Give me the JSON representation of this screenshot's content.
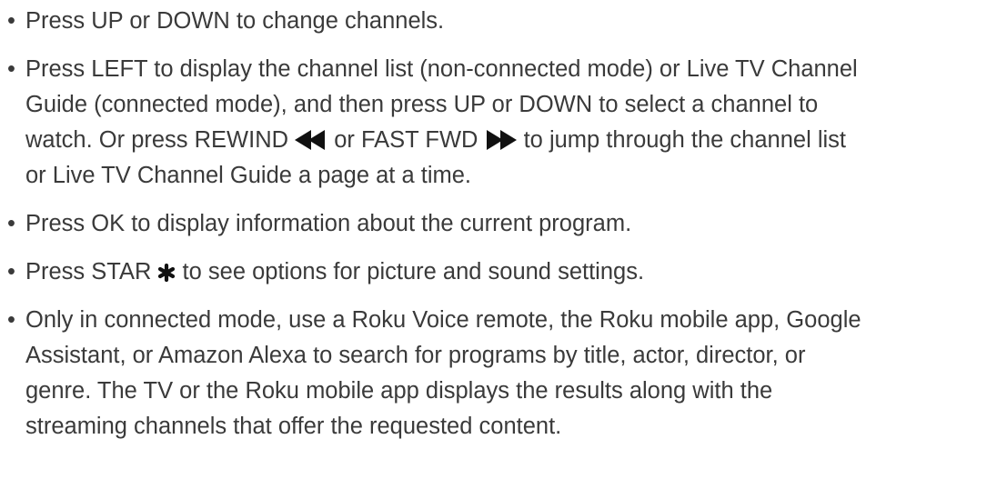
{
  "bullet_char": "•",
  "icons": {
    "rewind": "rewind-icon",
    "fast_forward": "fast-forward-icon",
    "star": "asterisk-icon"
  },
  "items": [
    {
      "lines": [
        "Press UP or DOWN to change channels."
      ]
    },
    {
      "lines": [
        "Press LEFT to display the channel list (non-connected mode) or Live TV Channel",
        "Guide (connected mode), and then press UP or DOWN to select a channel to"
      ],
      "line3_a": "watch. Or press REWIND ",
      "line3_b": " or FAST FWD ",
      "line3_c": " to jump through the channel list",
      "line4": "or Live TV Channel Guide a page at a time."
    },
    {
      "lines": [
        "Press OK to display information about the current program."
      ]
    },
    {
      "text_a": "Press STAR ",
      "text_b": " to see options for picture and sound settings."
    },
    {
      "lines": [
        "Only in connected mode, use a Roku Voice remote, the Roku mobile app, Google",
        "Assistant, or Amazon Alexa to search for programs by title, actor, director, or",
        "genre. The TV or the Roku mobile app displays the results along with the",
        "streaming channels that offer the requested content."
      ]
    }
  ]
}
